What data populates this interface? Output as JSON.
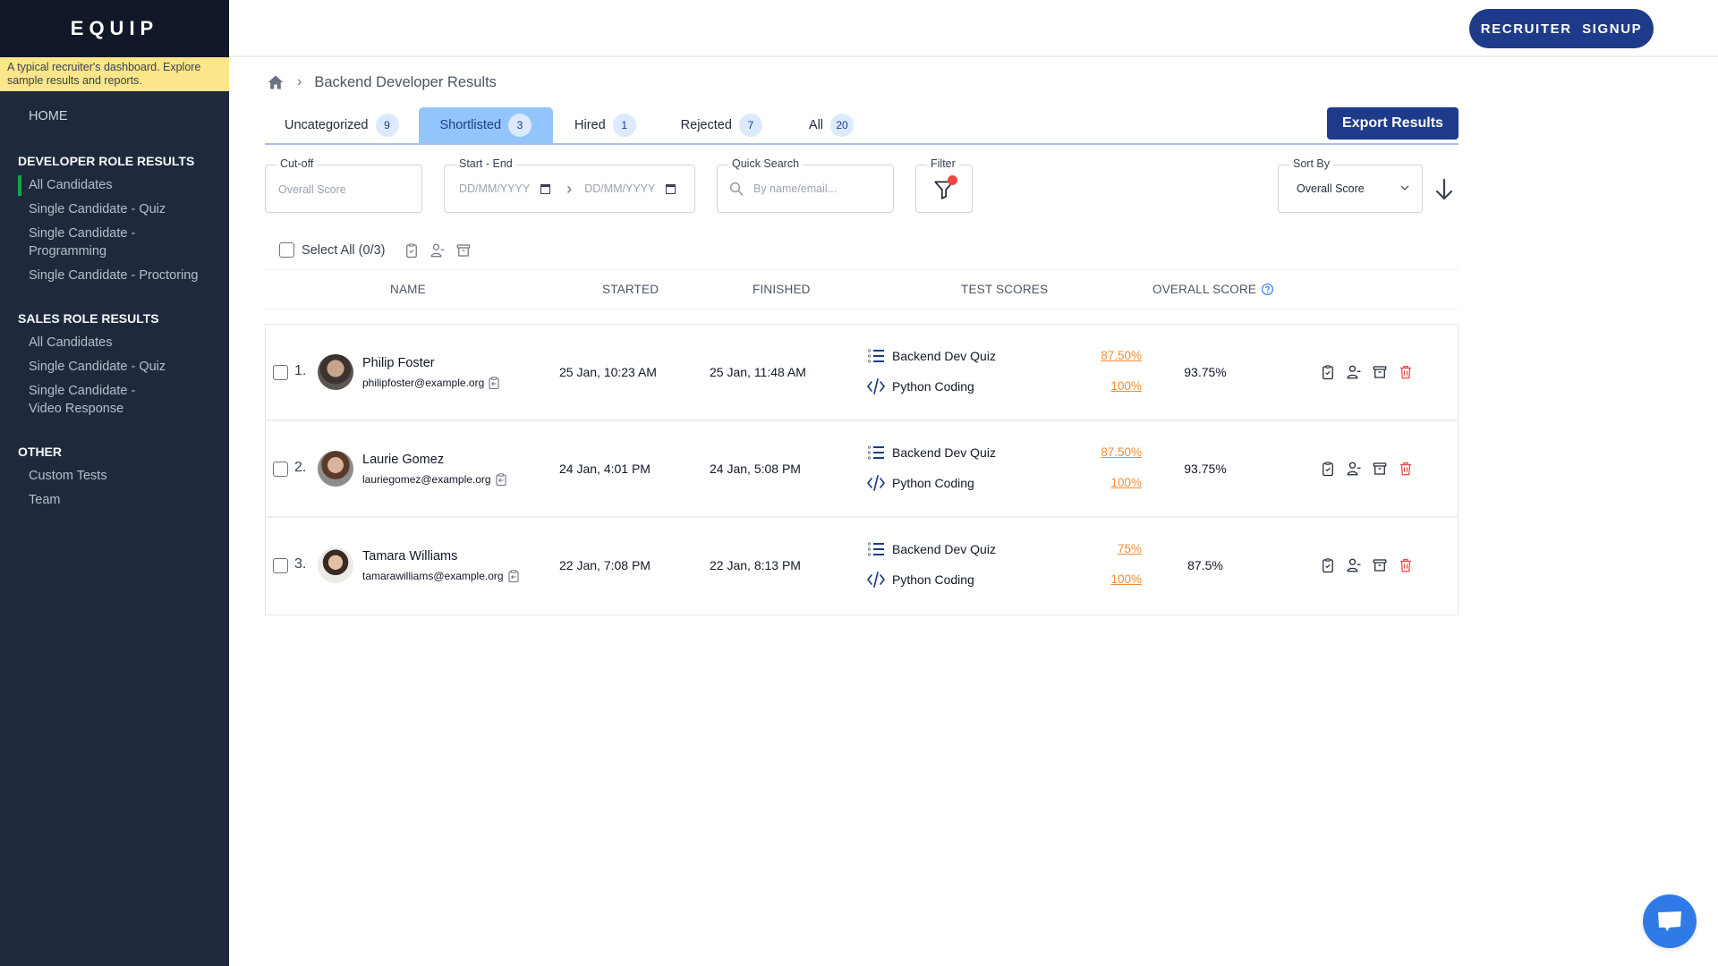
{
  "brand": {
    "name": "EQUIP"
  },
  "notice": "A typical recruiter's dashboard. Explore sample results and reports.",
  "sidebar": {
    "home": "HOME",
    "sections": [
      {
        "title": "DEVELOPER ROLE RESULTS",
        "items": [
          "All Candidates",
          "Single Candidate - Quiz",
          "Single Candidate - Programming",
          "Single Candidate - Proctoring"
        ]
      },
      {
        "title": "SALES ROLE RESULTS",
        "items": [
          "All Candidates",
          "Single Candidate - Quiz",
          "Single Candidate - Video Response"
        ]
      },
      {
        "title": "OTHER",
        "items": [
          "Custom Tests",
          "Team"
        ]
      }
    ],
    "active": "DEVELOPER ROLE RESULTS / All Candidates"
  },
  "topbar": {
    "signup_label": "RECRUITER  SIGNUP"
  },
  "breadcrumb": {
    "home_icon": "home-icon",
    "title": "Backend Developer Results"
  },
  "tabs": [
    {
      "label": "Uncategorized",
      "count": "9"
    },
    {
      "label": "Shortlisted",
      "count": "3",
      "active": true
    },
    {
      "label": "Hired",
      "count": "1"
    },
    {
      "label": "Rejected",
      "count": "7"
    },
    {
      "label": "All",
      "count": "20"
    }
  ],
  "export_label": "Export Results",
  "filters": {
    "cutoff": {
      "label": "Cut-off",
      "placeholder": "Overall Score"
    },
    "date": {
      "label": "Start - End",
      "start_placeholder": "DD/MM/YYYY",
      "end_placeholder": "DD/MM/YYYY"
    },
    "search": {
      "label": "Quick Search",
      "placeholder": "By name/email..."
    },
    "filter": {
      "label": "Filter",
      "active_indicator": true
    },
    "sort": {
      "label": "Sort By",
      "value": "Overall Score",
      "direction": "descending"
    }
  },
  "bulk": {
    "select_all_label": "Select All (0/3)"
  },
  "table": {
    "headers": {
      "name": "NAME",
      "started": "STARTED",
      "finished": "FINISHED",
      "test_scores": "TEST SCORES",
      "overall": "OVERALL SCORE"
    },
    "rows": [
      {
        "index": "1.",
        "name": "Philip Foster",
        "email": "philipfoster@example.org",
        "started": "25 Jan, 10:23 AM",
        "finished": "25 Jan, 11:48 AM",
        "tests": [
          {
            "name": "Backend Dev Quiz",
            "score": "87.50%"
          },
          {
            "name": "Python Coding",
            "score": "100%"
          }
        ],
        "overall": "93.75%"
      },
      {
        "index": "2.",
        "name": "Laurie Gomez",
        "email": "lauriegomez@example.org",
        "started": "24 Jan, 4:01 PM",
        "finished": "24 Jan, 5:08 PM",
        "tests": [
          {
            "name": "Backend Dev Quiz",
            "score": "87.50%"
          },
          {
            "name": "Python Coding",
            "score": "100%"
          }
        ],
        "overall": "93.75%"
      },
      {
        "index": "3.",
        "name": "Tamara Williams",
        "email": "tamarawilliams@example.org",
        "started": "22 Jan, 7:08 PM",
        "finished": "22 Jan, 8:13 PM",
        "tests": [
          {
            "name": "Backend Dev Quiz",
            "score": "75%"
          },
          {
            "name": "Python Coding",
            "score": "100%"
          }
        ],
        "overall": "87.5%"
      }
    ]
  },
  "colors": {
    "primary": "#1e3a8a",
    "active_tab": "#93c5fd",
    "score": "#f28c38",
    "delete": "#ef4444",
    "sidebar_bg": "#1e293b",
    "accent_bar": "#16a34a",
    "notice_bg": "#fde68a",
    "chat": "#2f7ae6"
  }
}
